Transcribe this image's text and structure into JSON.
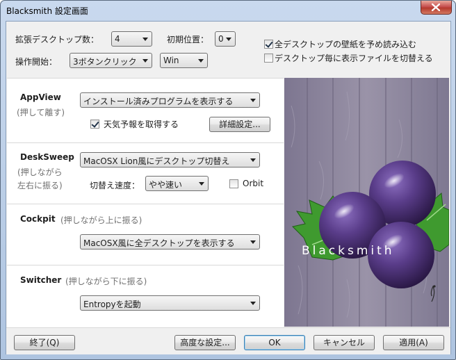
{
  "window": {
    "title": "Blacksmith 設定画面"
  },
  "top": {
    "desktops_label": "拡張デスクトップ数：",
    "desktops_value": "4",
    "initpos_label": "初期位置：",
    "initpos_value": "0",
    "start_label": "操作開始：",
    "start_value": "3ボタンクリック",
    "key_value": "Win",
    "preload_label": "全デスクトップの壁紙を予め読み込む",
    "preload_checked": true,
    "switchfile_label": "デスクトップ毎に表示ファイルを切替える",
    "switchfile_checked": false
  },
  "appview": {
    "title": "AppView",
    "subtitle": "(押して離す)",
    "action_value": "インストール済みプログラムを表示する",
    "weather_label": "天気予報を取得する",
    "weather_checked": true,
    "detail_button": "詳細設定..."
  },
  "desksweep": {
    "title": "DeskSweep",
    "subtitle_line1": "(押しながら",
    "subtitle_line2": "左右に振る)",
    "action_value": "MacOSX Lion風にデスクトップ切替え",
    "speed_label": "切替え速度：",
    "speed_value": "やや速い",
    "orbit_label": "Orbit",
    "orbit_checked": false
  },
  "cockpit": {
    "title": "Cockpit",
    "subtitle": "(押しながら上に振る)",
    "action_value": "MacOSX風に全デスクトップを表示する"
  },
  "switcher": {
    "title": "Switcher",
    "subtitle": "(押しながら下に振る)",
    "action_value": "Entropyを起動"
  },
  "hero": {
    "brand": "Blacksmith"
  },
  "buttons": {
    "exit": "終了(Q)",
    "advanced": "高度な設定...",
    "ok": "OK",
    "cancel": "キャンセル",
    "apply": "適用(A)"
  },
  "colors": {
    "berry": "#4a2f72",
    "leaf": "#3f9a2f",
    "wood": "#8e879a"
  }
}
